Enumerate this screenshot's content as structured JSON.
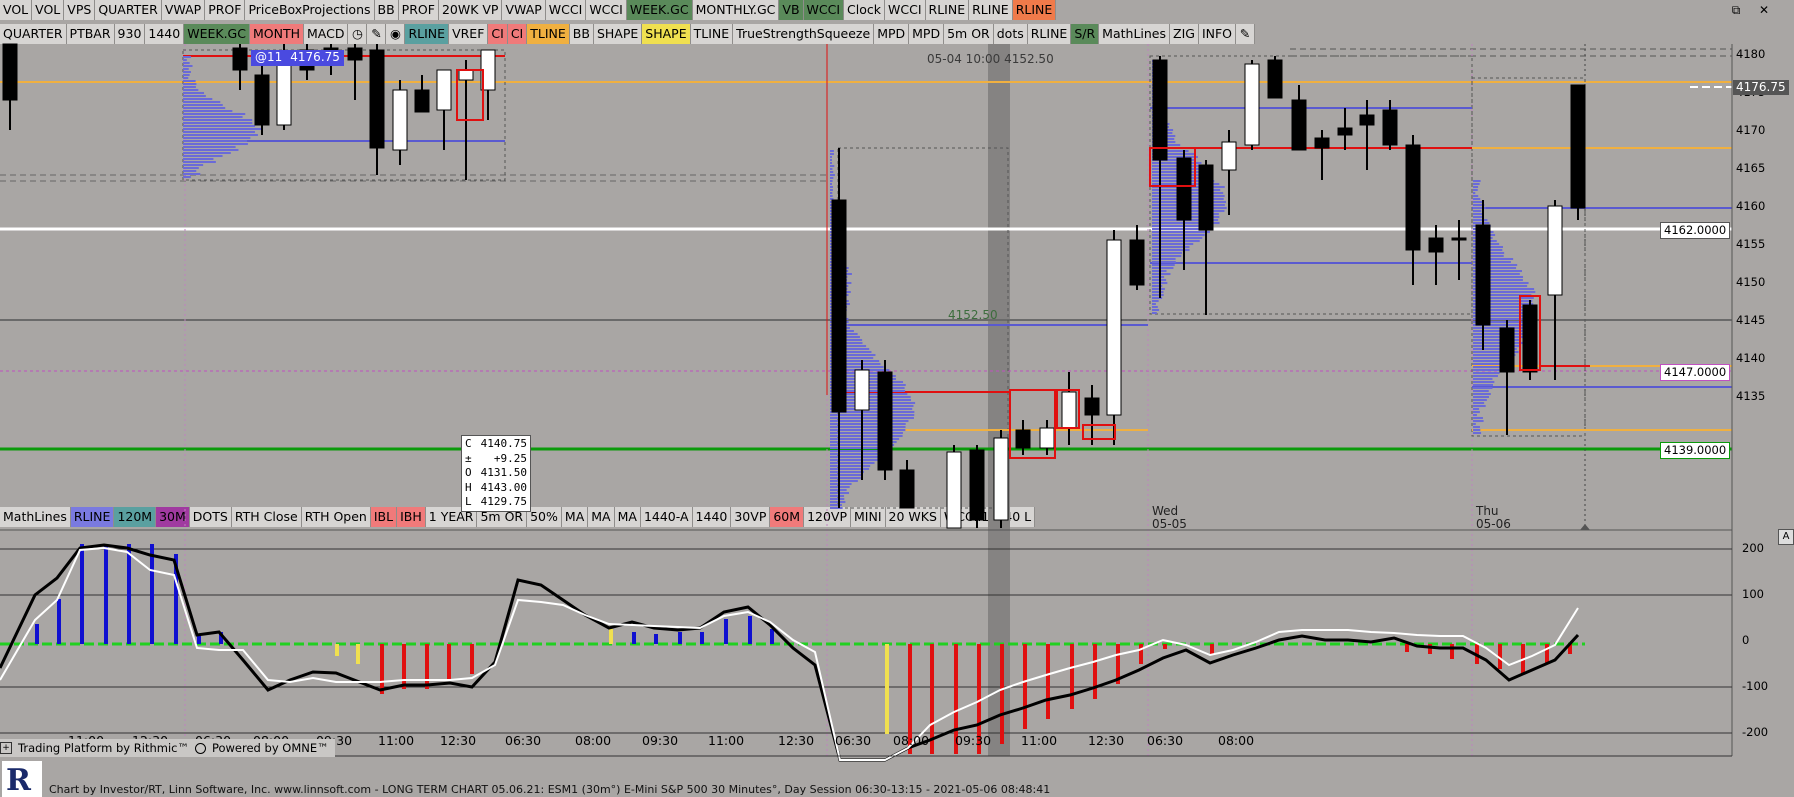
{
  "toolbar_top": [
    {
      "label": "VOL",
      "bg": "#d7d5d3",
      "fg": "#000"
    },
    {
      "label": "VOL",
      "bg": "#d7d5d3",
      "fg": "#000"
    },
    {
      "label": "VPS",
      "bg": "#d7d5d3",
      "fg": "#000"
    },
    {
      "label": "QUARTER",
      "bg": "#d7d5d3",
      "fg": "#000"
    },
    {
      "label": "VWAP",
      "bg": "#d7d5d3",
      "fg": "#000"
    },
    {
      "label": "PROF",
      "bg": "#d7d5d3",
      "fg": "#000"
    },
    {
      "label": "PriceBoxProjections",
      "bg": "#d7d5d3",
      "fg": "#000"
    },
    {
      "label": "BB",
      "bg": "#d7d5d3",
      "fg": "#000"
    },
    {
      "label": "PROF",
      "bg": "#d7d5d3",
      "fg": "#000"
    },
    {
      "label": "20WK VP",
      "bg": "#d7d5d3",
      "fg": "#000"
    },
    {
      "label": "VWAP",
      "bg": "#d7d5d3",
      "fg": "#000"
    },
    {
      "label": "WCCI",
      "bg": "#d7d5d3",
      "fg": "#000"
    },
    {
      "label": "WCCI",
      "bg": "#d7d5d3",
      "fg": "#000"
    },
    {
      "label": "WEEK.GC",
      "bg": "#5a8a5a",
      "fg": "#000"
    },
    {
      "label": "MONTHLY.GC",
      "bg": "#d7d5d3",
      "fg": "#000"
    },
    {
      "label": "VB",
      "bg": "#5a8a5a",
      "fg": "#000"
    },
    {
      "label": "WCCI",
      "bg": "#5a8a5a",
      "fg": "#000"
    },
    {
      "label": "Clock",
      "bg": "#d7d5d3",
      "fg": "#000"
    },
    {
      "label": "WCCI",
      "bg": "#d7d5d3",
      "fg": "#000"
    },
    {
      "label": "RLINE",
      "bg": "#d7d5d3",
      "fg": "#000"
    },
    {
      "label": "RLINE",
      "bg": "#d7d5d3",
      "fg": "#000"
    },
    {
      "label": "RLINE",
      "bg": "#f07a4a",
      "fg": "#000"
    }
  ],
  "toolbar_second": [
    {
      "label": "QUARTER",
      "bg": "#d7d5d3",
      "fg": "#000"
    },
    {
      "label": "PTBAR",
      "bg": "#d7d5d3",
      "fg": "#000"
    },
    {
      "label": "930",
      "bg": "#d7d5d3",
      "fg": "#000"
    },
    {
      "label": "1440",
      "bg": "#d7d5d3",
      "fg": "#000"
    },
    {
      "label": "WEEK.GC",
      "bg": "#5a8a5a",
      "fg": "#000"
    },
    {
      "label": "MONTH",
      "bg": "#f07a7a",
      "fg": "#000"
    },
    {
      "label": "MACD",
      "bg": "#d7d5d3",
      "fg": "#000"
    },
    {
      "icon": "clock-icon",
      "glyph": "◷",
      "bg": "#d7d5d3"
    },
    {
      "icon": "pencil-icon",
      "glyph": "✎",
      "bg": "#d7d5d3"
    },
    {
      "icon": "color-picker-icon",
      "glyph": "◉",
      "bg": "#d7d5d3"
    },
    {
      "label": "RLINE",
      "bg": "#5aa0a0",
      "fg": "#000"
    },
    {
      "label": "VREF",
      "bg": "#d7d5d3",
      "fg": "#000"
    },
    {
      "label": "CI",
      "bg": "#f07a7a",
      "fg": "#000"
    },
    {
      "label": "CI",
      "bg": "#f07a7a",
      "fg": "#000"
    },
    {
      "label": "TLINE",
      "bg": "#f0b040",
      "fg": "#000"
    },
    {
      "label": "BB",
      "bg": "#d7d5d3",
      "fg": "#000"
    },
    {
      "label": "SHAPE",
      "bg": "#d7d5d3",
      "fg": "#000"
    },
    {
      "label": "SHAPE",
      "bg": "#f0e050",
      "fg": "#000"
    },
    {
      "label": "TLINE",
      "bg": "#d7d5d3",
      "fg": "#000"
    },
    {
      "label": "TrueStrengthSqueeze",
      "bg": "#d7d5d3",
      "fg": "#000"
    },
    {
      "label": "MPD",
      "bg": "#d7d5d3",
      "fg": "#000"
    },
    {
      "label": "MPD",
      "bg": "#d7d5d3",
      "fg": "#000"
    },
    {
      "label": "5m OR",
      "bg": "#d7d5d3",
      "fg": "#000"
    },
    {
      "label": "dots",
      "bg": "#d7d5d3",
      "fg": "#000"
    },
    {
      "label": "RLINE",
      "bg": "#d7d5d3",
      "fg": "#000"
    },
    {
      "label": "S/R",
      "bg": "#5a8a5a",
      "fg": "#000"
    },
    {
      "label": "MathLines",
      "bg": "#d7d5d3",
      "fg": "#000"
    },
    {
      "label": "ZIG",
      "bg": "#d7d5d3",
      "fg": "#000"
    },
    {
      "label": "INFO",
      "bg": "#d7d5d3",
      "fg": "#000"
    },
    {
      "icon": "edit-icon",
      "glyph": "✎",
      "bg": "#d7d5d3"
    }
  ],
  "toolbar_lower": [
    {
      "label": "MathLines",
      "bg": "#d7d5d3",
      "fg": "#000"
    },
    {
      "label": "RLINE",
      "bg": "#7a7ae0",
      "fg": "#000"
    },
    {
      "label": "120M",
      "bg": "#5aa0a0",
      "fg": "#000"
    },
    {
      "label": "30M",
      "bg": "#a03aa0",
      "fg": "#000"
    },
    {
      "label": "DOTS",
      "bg": "#d7d5d3",
      "fg": "#000"
    },
    {
      "label": "RTH Close",
      "bg": "#d7d5d3",
      "fg": "#000"
    },
    {
      "label": "RTH Open",
      "bg": "#d7d5d3",
      "fg": "#000"
    },
    {
      "label": "IBL",
      "bg": "#f07a7a",
      "fg": "#000"
    },
    {
      "label": "IBH",
      "bg": "#f07a7a",
      "fg": "#000"
    },
    {
      "label": "1 YEAR",
      "bg": "#d7d5d3",
      "fg": "#000"
    },
    {
      "label": "5m OR",
      "bg": "#d7d5d3",
      "fg": "#000"
    },
    {
      "label": "50%",
      "bg": "#d7d5d3",
      "fg": "#000"
    },
    {
      "label": "MA",
      "bg": "#d7d5d3",
      "fg": "#000"
    },
    {
      "label": "MA",
      "bg": "#d7d5d3",
      "fg": "#000"
    },
    {
      "label": "MA",
      "bg": "#d7d5d3",
      "fg": "#000"
    },
    {
      "label": "1440-A",
      "bg": "#d7d5d3",
      "fg": "#000"
    },
    {
      "label": "1440",
      "bg": "#d7d5d3",
      "fg": "#000"
    },
    {
      "label": "30VP",
      "bg": "#d7d5d3",
      "fg": "#000"
    },
    {
      "label": "60M",
      "bg": "#f07a7a",
      "fg": "#000"
    },
    {
      "label": "120VP",
      "bg": "#d7d5d3",
      "fg": "#000"
    },
    {
      "label": "MINI",
      "bg": "#d7d5d3",
      "fg": "#000"
    },
    {
      "label": "20 WKS",
      "bg": "#d7d5d3",
      "fg": "#000"
    },
    {
      "label": "WCCI.1",
      "bg": "#d7d5d3",
      "fg": "#000"
    },
    {
      "label": "240 L",
      "bg": "#d7d5d3",
      "fg": "#000"
    }
  ],
  "window_controls": {
    "restore": "⧉",
    "close": "✕"
  },
  "price_axis": [
    "4180",
    "4175",
    "4170",
    "4165",
    "4160",
    "4155",
    "4150",
    "4145",
    "4140",
    "4135"
  ],
  "price_tags": {
    "last": "4176.75",
    "white_line": "4162.0000",
    "pink_line": "4147.0000",
    "green_line": "4139.0000"
  },
  "indicator_axis": [
    "200",
    "100",
    "0",
    "-100",
    "-200"
  ],
  "time_axis": [
    "11:00",
    "12:30",
    "06:30",
    "08:00",
    "09:30",
    "11:00",
    "12:30",
    "06:30",
    "08:00",
    "09:30",
    "11:00",
    "12:30",
    "06:30",
    "08:00",
    "09:30",
    "11:00",
    "12:30",
    "06:30",
    "08:00"
  ],
  "day_labels": [
    {
      "day": "Wed",
      "date": "05-05"
    },
    {
      "day": "Thu",
      "date": "05-06"
    }
  ],
  "annotations": {
    "top_label": "05-04 10:00 4152.50",
    "mid_label": "4152.50",
    "overlay_text_1": "@11",
    "overlay_text_2": "4176.75"
  },
  "info_box": [
    {
      "k": "C",
      "v": "4140.75"
    },
    {
      "k": "±",
      "v": "+9.25"
    },
    {
      "k": "O",
      "v": "4131.50"
    },
    {
      "k": "H",
      "v": "4143.00"
    },
    {
      "k": "L",
      "v": "4129.75"
    }
  ],
  "brand": {
    "platform": "Trading Platform by Rithmic™",
    "powered": "Powered by OMNE™"
  },
  "indicator_panel_label": "A",
  "footer": "Chart by Investor/RT, Linn Software, Inc. www.linnsoft.com - LONG TERM CHART   05.06.21: ESM1 (30m°) E-Mini S&P 500 30 Minutes°, Day Session 06:30-13:15 - 2021-05-06 08:48:41",
  "colors": {
    "background": "#a9a6a4",
    "candle_up": "#ffffff",
    "candle_down": "#000000",
    "volume_profile": "#6a6ad8",
    "green_line": "#0a9a0a",
    "orange_line": "#f0b040",
    "red_line": "#e01010",
    "blue_line": "#5a5ad0",
    "cci_up": "#1010d0",
    "cci_down": "#e01010"
  }
}
